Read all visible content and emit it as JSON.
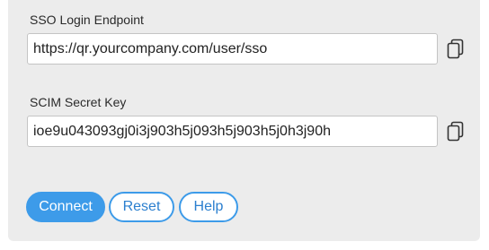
{
  "fields": {
    "sso_endpoint": {
      "label": "SSO Login Endpoint",
      "value": "https://qr.yourcompany.com/user/sso",
      "copy_icon": "copy-icon"
    },
    "scim_secret": {
      "label": "SCIM Secret Key",
      "value": "ioe9u043093gj0i3j903h5j093h5j903h5j0h3j90h",
      "copy_icon": "copy-icon"
    }
  },
  "actions": {
    "connect_label": "Connect",
    "reset_label": "Reset",
    "help_label": "Help"
  },
  "colors": {
    "accent": "#3d9be9",
    "panel_bg": "#ececec"
  }
}
